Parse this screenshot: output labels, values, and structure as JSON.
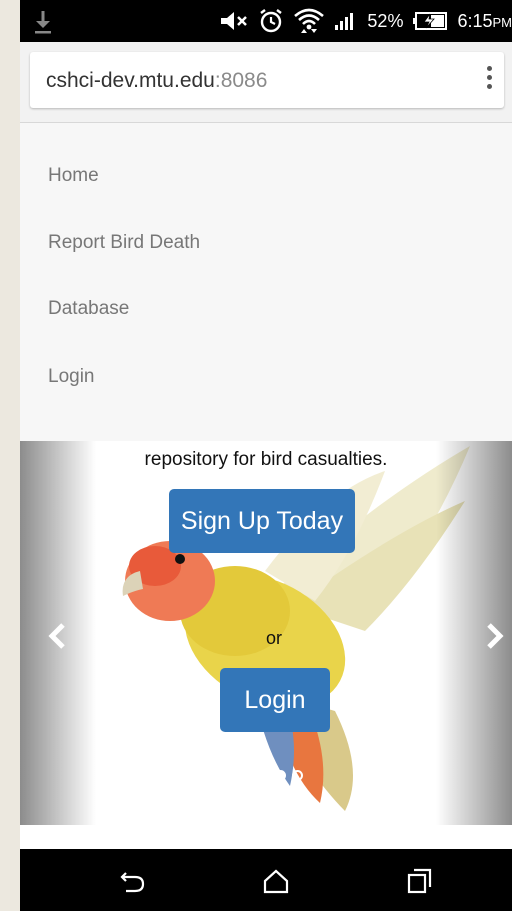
{
  "status_bar": {
    "battery_percent": "52%",
    "time": "6:15",
    "time_suffix": "PM",
    "icons": [
      "download-icon",
      "volume-muted-icon",
      "alarm-icon",
      "wifi-icon",
      "signal-icon",
      "battery-charging-icon"
    ]
  },
  "browser": {
    "url_host": "cshci-dev.mtu.edu",
    "url_port": ":8086",
    "menu_icon": "overflow-menu-icon"
  },
  "nav": {
    "items": [
      {
        "label": "Home"
      },
      {
        "label": "Report Bird Death"
      },
      {
        "label": "Database"
      },
      {
        "label": "Login"
      }
    ]
  },
  "carousel": {
    "tagline": "repository for bird casualties.",
    "signup_label": "Sign Up Today",
    "or_text": "or",
    "login_label": "Login",
    "prev_icon": "chevron-left-icon",
    "next_icon": "chevron-right-icon",
    "slide_count": 3,
    "active_slide": 1,
    "button_color": "#3376b8"
  },
  "android_nav": {
    "icons": [
      "back-icon",
      "home-icon",
      "recent-apps-icon"
    ]
  }
}
